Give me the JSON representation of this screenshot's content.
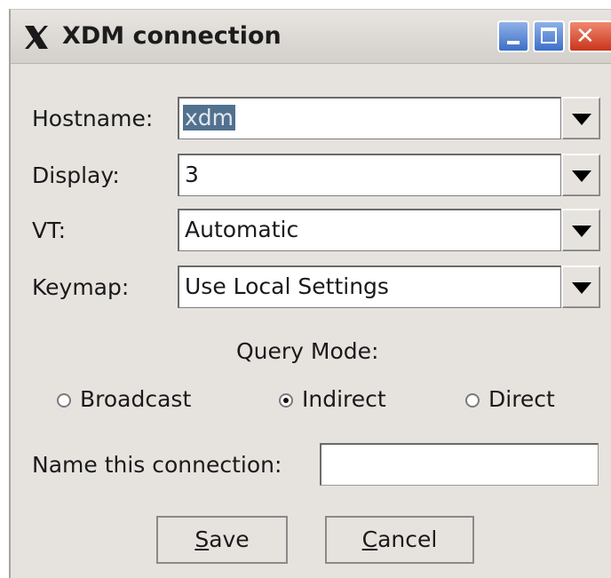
{
  "window": {
    "title": "XDM connection",
    "buttons": {
      "minimize": "minimize",
      "maximize": "maximize",
      "close": "close"
    }
  },
  "fields": [
    {
      "label": "Hostname:",
      "value": "xdm"
    },
    {
      "label": "Display:",
      "value": "3"
    },
    {
      "label": "VT:",
      "value": "Automatic"
    },
    {
      "label": "Keymap:",
      "value": "Use Local Settings"
    }
  ],
  "query_mode": {
    "label": "Query Mode:",
    "options": [
      "Broadcast",
      "Indirect",
      "Direct"
    ],
    "selected": "Indirect"
  },
  "connection_name": {
    "label": "Name this connection:",
    "value": ""
  },
  "actions": {
    "save_mnemonic": "S",
    "save_rest": "ave",
    "cancel_mnemonic": "C",
    "cancel_rest": "ancel"
  },
  "colors": {
    "window_bg": "#e6e3df",
    "selection": "#52718f",
    "close_button": "#c9341b"
  }
}
